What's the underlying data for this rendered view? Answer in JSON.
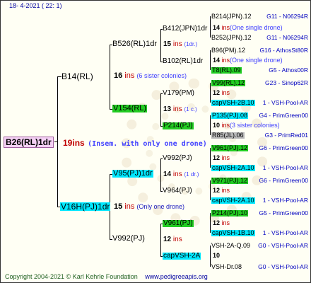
{
  "header": "18-   4-2021 ( 22:  1)",
  "footer": {
    "copyright": "Copyright 2004-2021 © Karl Kehrle Foundation",
    "url": "www.pedigreeapis.org"
  },
  "root": {
    "label": "B26(RL)1dr",
    "ins_num": "19",
    "ins": "ins",
    "note": "(Insem. with only one drone)"
  },
  "f1_top": {
    "label": "B14(RL)",
    "ins_num": "16",
    "ins": "ins",
    "note": "(6 sister colonies)"
  },
  "f1_bot": {
    "label": "V16H(PJ)1dr",
    "ins_num": "15",
    "ins": "ins",
    "note": "(Only one drone)"
  },
  "f2_a": {
    "label": "B526(RL)1dr",
    "ins_num": "15",
    "ins": "ins",
    "note": "(1dr.)"
  },
  "f2_b": {
    "label": "V154(RL)",
    "ins_num": "13",
    "ins": "ins",
    "note": "(1 c.)"
  },
  "f2_c": {
    "label": "V95(PJ)1dr",
    "ins_num": "14",
    "ins": "ins",
    "note": "(1 dr.)"
  },
  "f2_d": {
    "label": "V992(PJ)",
    "ins_num": "12",
    "ins": "ins",
    "note": ""
  },
  "f3": [
    {
      "label": "B412(JPN)1dr",
      "ins_num": "14",
      "ins": "ins",
      "note": "(One single drone)"
    },
    {
      "label": "B102(RL)1dr",
      "ins_num": "14",
      "ins": "ins",
      "note": "(One single drone)"
    },
    {
      "label": "V179(PM)",
      "ins_num": "12",
      "ins": "ins",
      "note": ""
    },
    {
      "label": "P214(PJ)",
      "ins_num": "10",
      "ins": "ins",
      "note": "(3 sister colonies)"
    },
    {
      "label": "V992(PJ)",
      "ins_num": "12",
      "ins": "ins",
      "note": ""
    },
    {
      "label": "V964(PJ)",
      "ins_num": "12",
      "ins": "ins",
      "note": ""
    },
    {
      "label": "V961(PJ)",
      "ins_num": "12",
      "ins": "ins",
      "note": ""
    },
    {
      "label": "capVSH-2A",
      "ins_num": "10",
      "ins": "",
      "note": ""
    }
  ],
  "f4": [
    {
      "label": "B214(JPN).12",
      "code": "G11 - N06294R"
    },
    {
      "label": "B252(JPN).12",
      "code": "G11 - N06294R"
    },
    {
      "label": "B96(PM).12",
      "code": "G16 - AthosSt80R"
    },
    {
      "label": "T8(RL).09",
      "code": "G5 - Athos00R"
    },
    {
      "label": "V99(RL).12",
      "code": "G23 - Sinop62R"
    },
    {
      "label": "capVSH-2B.10",
      "code": "1 - VSH-Pool-AR"
    },
    {
      "label": "P135(PJ).08",
      "code": "G4 - PrimGreen00"
    },
    {
      "label": "R85(JL).06",
      "code": "G3 - PrimRed01"
    },
    {
      "label": "V961(PJ).12",
      "code": "G6 - PrimGreen00"
    },
    {
      "label": "capVSH-2A.10",
      "code": "1 - VSH-Pool-AR"
    },
    {
      "label": "V971(PJ).12",
      "code": "G6 - PrimGreen00"
    },
    {
      "label": "capVSH-2A.10",
      "code": "1 - VSH-Pool-AR"
    },
    {
      "label": "P214(PJ).10",
      "code": "G5 - PrimGreen00"
    },
    {
      "label": "capVSH-1B.10",
      "code": "1 - VSH-Pool-AR"
    },
    {
      "label": "VSH-2A-Q.09",
      "code": "G0 - VSH-Pool-AR"
    },
    {
      "label": "VSH-Dr.08",
      "code": "G0 - VSH-Pool-AR"
    }
  ]
}
